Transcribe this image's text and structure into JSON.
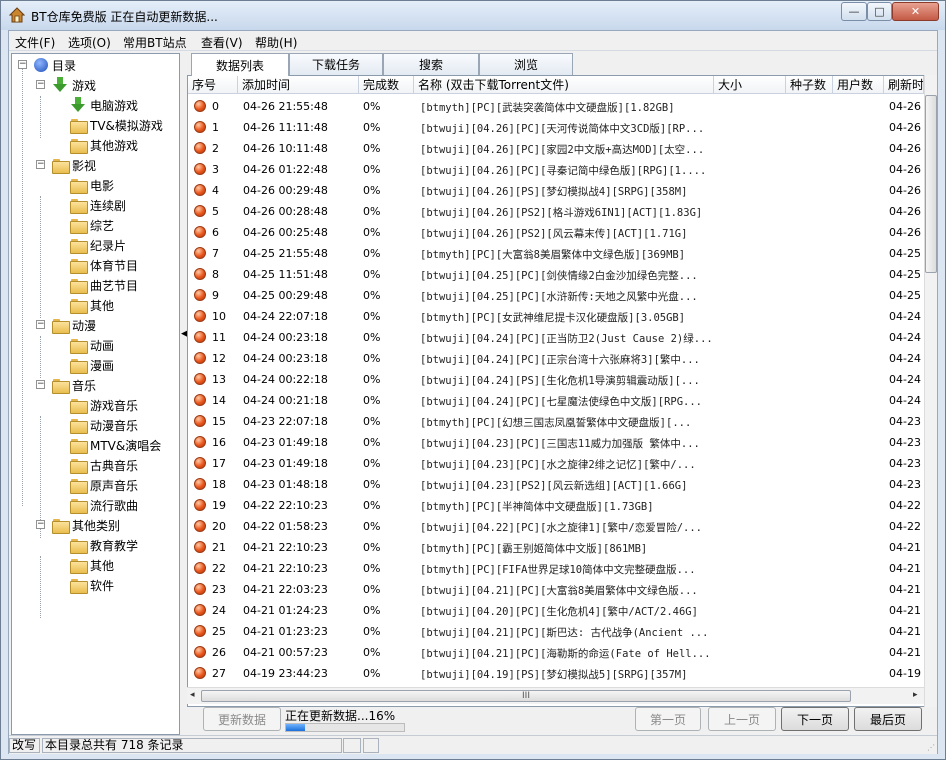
{
  "window": {
    "title": "BT仓库免费版  正在自动更新数据...",
    "controls": {
      "minimize": "—",
      "maximize": "□",
      "close": "✕"
    }
  },
  "menu": [
    "文件(F)",
    "选项(O)",
    "常用BT站点",
    "查看(V)",
    "帮助(H)"
  ],
  "tree": {
    "root": "目录",
    "categories": [
      {
        "label": "游戏",
        "icon": "green-arrow-icon",
        "children": [
          {
            "label": "电脑游戏",
            "icon": "green-arrow-icon"
          },
          {
            "label": "TV&模拟游戏",
            "icon": "folder-icon"
          },
          {
            "label": "其他游戏",
            "icon": "folder-icon"
          }
        ]
      },
      {
        "label": "影视",
        "icon": "folder-icon",
        "children": [
          {
            "label": "电影"
          },
          {
            "label": "连续剧"
          },
          {
            "label": "综艺"
          },
          {
            "label": "纪录片"
          },
          {
            "label": "体育节目"
          },
          {
            "label": "曲艺节目"
          },
          {
            "label": "其他"
          }
        ]
      },
      {
        "label": "动漫",
        "icon": "folder-icon",
        "children": [
          {
            "label": "动画"
          },
          {
            "label": "漫画"
          }
        ]
      },
      {
        "label": "音乐",
        "icon": "folder-icon",
        "children": [
          {
            "label": "游戏音乐"
          },
          {
            "label": "动漫音乐"
          },
          {
            "label": "MTV&演唱会"
          },
          {
            "label": "古典音乐"
          },
          {
            "label": "原声音乐"
          },
          {
            "label": "流行歌曲"
          }
        ]
      },
      {
        "label": "其他类别",
        "icon": "folder-icon",
        "children": [
          {
            "label": "教育教学"
          },
          {
            "label": "其他"
          },
          {
            "label": "软件"
          }
        ]
      }
    ]
  },
  "tabs": [
    "数据列表",
    "下载任务",
    "搜索",
    "浏览"
  ],
  "active_tab": "数据列表",
  "table": {
    "columns": [
      "序号",
      "添加时间",
      "完成数",
      "名称 (双击下载Torrent文件)",
      "大小",
      "种子数",
      "用户数",
      "刷新时"
    ],
    "rows": [
      {
        "idx": "0",
        "time": "04-26 21:55:48",
        "done": "0%",
        "name": "[btmyth][PC][武装突袭简体中文硬盘版][1.82GB]",
        "refresh": "04-26"
      },
      {
        "idx": "1",
        "time": "04-26 11:11:48",
        "done": "0%",
        "name": "[btwuji][04.26][PC][天河传说简体中文3CD版][RP...",
        "refresh": "04-26"
      },
      {
        "idx": "2",
        "time": "04-26 10:11:48",
        "done": "0%",
        "name": "[btwuji][04.26][PC][家园2中文版+高达MOD][太空...",
        "refresh": "04-26"
      },
      {
        "idx": "3",
        "time": "04-26 01:22:48",
        "done": "0%",
        "name": "[btwuji][04.26][PC][寻秦记简中绿色版][RPG][1....",
        "refresh": "04-26"
      },
      {
        "idx": "4",
        "time": "04-26 00:29:48",
        "done": "0%",
        "name": "[btwuji][04.26][PS][梦幻模拟战4][SRPG][358M]",
        "refresh": "04-26"
      },
      {
        "idx": "5",
        "time": "04-26 00:28:48",
        "done": "0%",
        "name": "[btwuji][04.26][PS2][格斗游戏6IN1][ACT][1.83G]",
        "refresh": "04-26"
      },
      {
        "idx": "6",
        "time": "04-26 00:25:48",
        "done": "0%",
        "name": "[btwuji][04.26][PS2][风云幕末传][ACT][1.71G]",
        "refresh": "04-26"
      },
      {
        "idx": "7",
        "time": "04-25 21:55:48",
        "done": "0%",
        "name": "[btmyth][PC][大富翁8美眉繁体中文绿色版][369MB]",
        "refresh": "04-25"
      },
      {
        "idx": "8",
        "time": "04-25 11:51:48",
        "done": "0%",
        "name": "[btwuji][04.25][PC][剑侠情缘2白金沙加绿色完整...",
        "refresh": "04-25"
      },
      {
        "idx": "9",
        "time": "04-25 00:29:48",
        "done": "0%",
        "name": "[btwuji][04.25][PC][水浒新传:天地之风繁中光盘...",
        "refresh": "04-25"
      },
      {
        "idx": "10",
        "time": "04-24 22:07:18",
        "done": "0%",
        "name": "[btmyth][PC][女武神维尼提卡汉化硬盘版][3.05GB]",
        "refresh": "04-24"
      },
      {
        "idx": "11",
        "time": "04-24 00:23:18",
        "done": "0%",
        "name": "[btwuji][04.24][PC][正当防卫2(Just Cause 2)绿...",
        "refresh": "04-24"
      },
      {
        "idx": "12",
        "time": "04-24 00:23:18",
        "done": "0%",
        "name": "[btwuji][04.24][PC][正宗台湾十六张麻将3][繁中...",
        "refresh": "04-24"
      },
      {
        "idx": "13",
        "time": "04-24 00:22:18",
        "done": "0%",
        "name": "[btwuji][04.24][PS][生化危机1导演剪辑震动版][...",
        "refresh": "04-24"
      },
      {
        "idx": "14",
        "time": "04-24 00:21:18",
        "done": "0%",
        "name": "[btwuji][04.24][PC][七星魔法使绿色中文版][RPG...",
        "refresh": "04-24"
      },
      {
        "idx": "15",
        "time": "04-23 22:07:18",
        "done": "0%",
        "name": "[btmyth][PC][幻想三国志凤凰誓繁体中文硬盘版][...",
        "refresh": "04-23"
      },
      {
        "idx": "16",
        "time": "04-23 01:49:18",
        "done": "0%",
        "name": "[btwuji][04.23][PC][三国志11威力加强版 繁体中...",
        "refresh": "04-23"
      },
      {
        "idx": "17",
        "time": "04-23 01:49:18",
        "done": "0%",
        "name": "[btwuji][04.23][PC][水之旋律2绯之记忆][繁中/...",
        "refresh": "04-23"
      },
      {
        "idx": "18",
        "time": "04-23 01:48:18",
        "done": "0%",
        "name": "[btwuji][04.23][PS2][风云新选组][ACT][1.66G]",
        "refresh": "04-23"
      },
      {
        "idx": "19",
        "time": "04-22 22:10:23",
        "done": "0%",
        "name": "[btmyth][PC][半神简体中文硬盘版][1.73GB]",
        "refresh": "04-22"
      },
      {
        "idx": "20",
        "time": "04-22 01:58:23",
        "done": "0%",
        "name": "[btwuji][04.22][PC][水之旋律1][繁中/恋爱冒险/...",
        "refresh": "04-22"
      },
      {
        "idx": "21",
        "time": "04-21 22:10:23",
        "done": "0%",
        "name": "[btmyth][PC][霸王别姬简体中文版][861MB]",
        "refresh": "04-21"
      },
      {
        "idx": "22",
        "time": "04-21 22:10:23",
        "done": "0%",
        "name": "[btmyth][PC][FIFA世界足球10简体中文完整硬盘版...",
        "refresh": "04-21"
      },
      {
        "idx": "23",
        "time": "04-21 22:03:23",
        "done": "0%",
        "name": "[btwuji][04.21][PC][大富翁8美眉繁体中文绿色版...",
        "refresh": "04-21"
      },
      {
        "idx": "24",
        "time": "04-21 01:24:23",
        "done": "0%",
        "name": "[btwuji][04.20][PC][生化危机4][繁中/ACT/2.46G]",
        "refresh": "04-21"
      },
      {
        "idx": "25",
        "time": "04-21 01:23:23",
        "done": "0%",
        "name": "[btwuji][04.21][PC][斯巴达: 古代战争(Ancient ...",
        "refresh": "04-21"
      },
      {
        "idx": "26",
        "time": "04-21 00:57:23",
        "done": "0%",
        "name": "[btwuji][04.21][PC][海勒斯的命运(Fate of Hell...",
        "refresh": "04-21"
      },
      {
        "idx": "27",
        "time": "04-19 23:44:23",
        "done": "0%",
        "name": "[btwuji][04.19][PS][梦幻模拟战5][SRPG][357M]",
        "refresh": "04-19"
      }
    ]
  },
  "bottom": {
    "update_button": "更新数据",
    "progress_text": "正在更新数据...16%",
    "progress_fraction": 0.16,
    "first_page": "第一页",
    "prev_page": "上一页",
    "next_page": "下一页",
    "last_page": "最后页"
  },
  "status": {
    "mode": "改写",
    "message": "本目录总共有 718 条记录"
  },
  "scroll": {
    "left": "◂",
    "right": "▸",
    "grip": "III",
    "splitter": "◀"
  }
}
